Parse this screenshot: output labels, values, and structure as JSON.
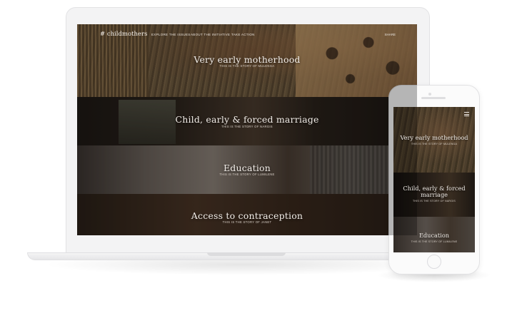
{
  "site": {
    "logo": "# childmothers",
    "nav": [
      "EXPLORE THE ISSUES",
      "ABOUT THE INITIATIVE",
      "TAKE ACTION"
    ],
    "share": "SHARE"
  },
  "stories": [
    {
      "title": "Very early motherhood",
      "subtitle": "THIS IS THE STORY OF MULENGA"
    },
    {
      "title": "Child, early & forced marriage",
      "subtitle": "THIS IS THE STORY OF NARGIS"
    },
    {
      "title": "Education",
      "subtitle": "THIS IS THE STORY OF LUMILENE"
    },
    {
      "title": "Access to contraception",
      "subtitle": "THIS IS THE STORY OF JANET"
    }
  ],
  "phone": {
    "menu_icon": "hamburger-icon",
    "stories": [
      {
        "title": "Very early motherhood",
        "subtitle": "THIS IS THE STORY OF MULENGA"
      },
      {
        "title": "Child, early & forced marriage",
        "subtitle": "THIS IS THE STORY OF NARGIS"
      },
      {
        "title": "Education",
        "subtitle": "THIS IS THE STORY OF LUMILENE"
      }
    ]
  }
}
